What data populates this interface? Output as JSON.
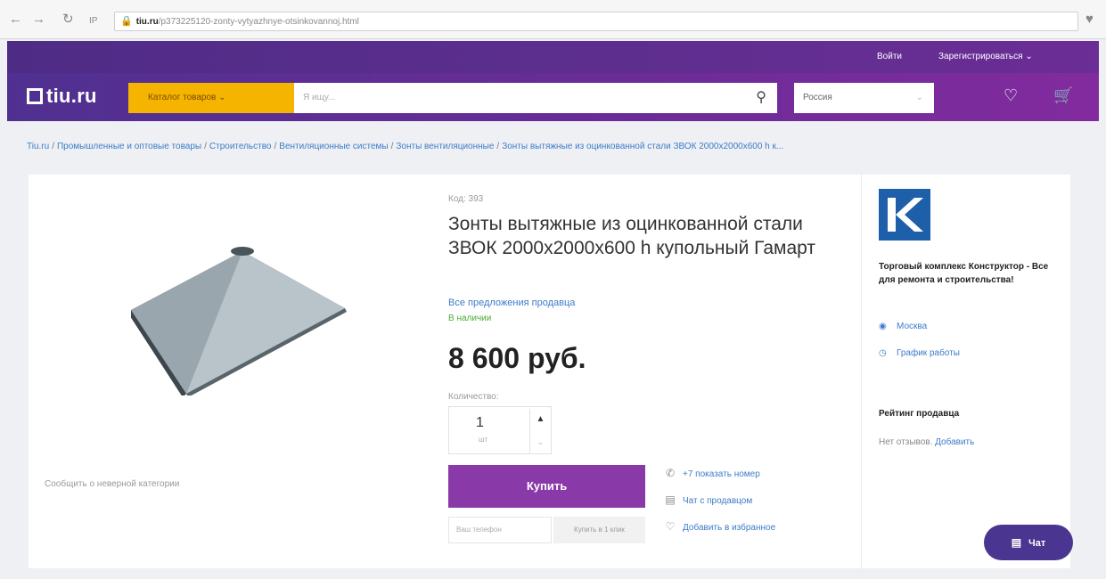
{
  "browser": {
    "host": "tiu.ru",
    "path": "/p373225120-zonty-vytyazhnye-otsinkovannoj.html",
    "lock_icon": "lock-icon",
    "nav_icons": [
      "back-icon",
      "forward-icon",
      "reload-icon",
      "ip-icon"
    ],
    "bookmark_icon": "heart-icon"
  },
  "header": {
    "login": "Войти",
    "register": "Зарегистрироваться",
    "logo_text": "tiu.ru",
    "catalog_label": "Каталог товаров",
    "search_placeholder": "Я ищу...",
    "region": "Россия",
    "colors": {
      "top": "#4e2c86",
      "main_end": "#822b9e",
      "catalog": "#f4b400"
    }
  },
  "breadcrumb": [
    "Tiu.ru",
    "Промышленные и оптовые товары",
    "Строительство",
    "Вентиляционные системы",
    "Зонты вентиляционные",
    "Зонты вытяжные из оцинкованной стали ЗВОК 2000х2000х600 h к..."
  ],
  "product": {
    "code": "Код: 393",
    "title": "Зонты вытяжные из оцинкованной стали ЗВОК 2000х2000х600 h купольный Гамарт",
    "seller_offers": "Все предложения продавца",
    "availability": "В наличии",
    "price": "8 600 руб.",
    "quantity_label": "Количество:",
    "quantity_value": "1",
    "quantity_unit": "шт",
    "buy_label": "Купить",
    "phone_placeholder": "Ваш телефон",
    "one_click_label": "Купить в 1 клик",
    "report_link": "Сообщить о неверной категории",
    "actions": [
      {
        "icon": "phone-icon",
        "label": "+7 показать номер"
      },
      {
        "icon": "chat-icon",
        "label": "Чат с продавцом"
      },
      {
        "icon": "heart-icon",
        "label": "Добавить в избранное"
      }
    ],
    "colors": {
      "buy": "#8a3aa8",
      "link": "#3d7cc9",
      "stock": "#4caa3a"
    }
  },
  "seller": {
    "logo_letter": "K",
    "name": "Торговый комплекс Конструктор - Все для ремонта и строительства!",
    "city": "Москва",
    "schedule": "График работы",
    "rating_title": "Рейтинг продавца",
    "no_reviews": "Нет отзывов.",
    "add_review": "Добавить"
  },
  "chat": {
    "label": "Чат"
  }
}
